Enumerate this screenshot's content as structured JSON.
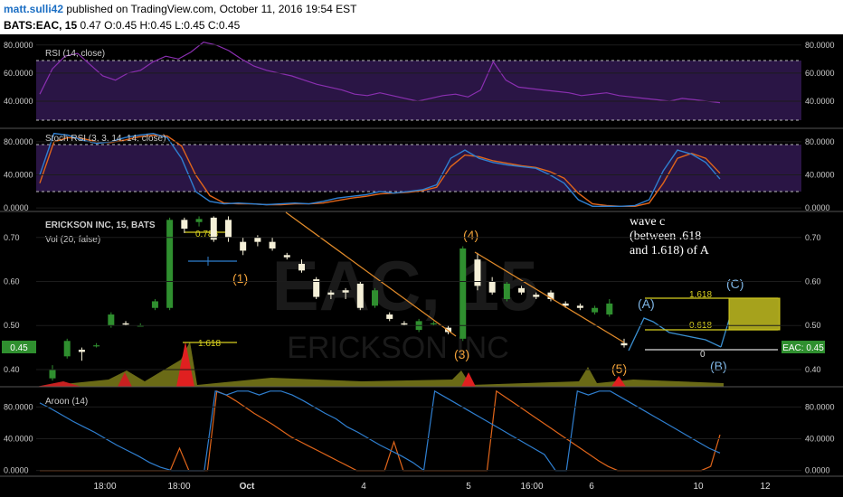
{
  "header": {
    "username": "matt.sulli42",
    "published": " published on TradingView.com, October 11, 2016 19:54 EST",
    "symbol": "BATS:EAC, 15",
    "ohlc": " 0.47 O:0.45 H:0.45 L:0.45 C:0.45"
  },
  "colors": {
    "panel_bg": "#000000",
    "rsi_band": "#3a1a55",
    "rsi_line": "#8a2fb0",
    "stoch_k": "#2f7fd0",
    "stoch_d": "#e0651a",
    "up_candle": "#2f8f2f",
    "down_candle": "#f5f0d8",
    "wave_label": "#f2a23a",
    "corrective_label": "#7fb6e6",
    "trendline": "#e08a2a",
    "fib": "#d8d020",
    "price_tag": "#2f8f2f"
  },
  "chart_data": [
    {
      "type": "line",
      "title": "RSI (14, close)",
      "ylim": [
        22,
        85
      ],
      "y_ticks": [
        "80.0000",
        "60.0000",
        "40.0000"
      ],
      "overbought": 70,
      "oversold": 30,
      "series": [
        {
          "values": [
            45,
            63,
            72,
            74,
            66,
            58,
            55,
            60,
            62,
            68,
            72,
            70,
            75,
            82,
            80,
            76,
            70,
            65,
            62,
            60,
            58,
            55,
            52,
            50,
            48,
            45,
            44,
            46,
            44,
            42,
            40,
            42,
            44,
            45,
            43,
            48,
            68,
            55,
            50,
            49,
            48,
            47,
            46,
            44,
            45,
            46,
            44,
            43,
            42,
            41,
            40,
            42,
            41,
            40,
            39
          ]
        }
      ]
    },
    {
      "type": "line",
      "title": "Stoch RSI (3, 3, 14, 14, close)",
      "ylim": [
        -2,
        93
      ],
      "y_ticks": [
        "80.0000",
        "40.0000",
        "0.0000"
      ],
      "upper_band": 80,
      "lower_band": 20,
      "series": [
        {
          "values": [
            40,
            90,
            88,
            82,
            78,
            80,
            85,
            88,
            90,
            85,
            60,
            20,
            8,
            5,
            6,
            5,
            4,
            5,
            6,
            5,
            8,
            12,
            14,
            16,
            20,
            18,
            20,
            22,
            28,
            60,
            70,
            60,
            55,
            52,
            50,
            48,
            40,
            30,
            10,
            2,
            2,
            2,
            3,
            10,
            45,
            70,
            65,
            55,
            35
          ]
        },
        {
          "values": [
            30,
            80,
            85,
            84,
            80,
            79,
            82,
            86,
            88,
            87,
            75,
            40,
            15,
            6,
            5,
            5,
            4,
            4,
            5,
            5,
            6,
            9,
            12,
            14,
            17,
            18,
            19,
            21,
            25,
            50,
            64,
            62,
            57,
            54,
            51,
            49,
            44,
            36,
            18,
            5,
            3,
            2,
            2,
            6,
            30,
            60,
            66,
            60,
            42
          ]
        }
      ]
    },
    {
      "type": "candlestick",
      "title": "ERICKSON INC, 15, BATS",
      "ylim": [
        0.365,
        0.755
      ],
      "y_ticks": [
        "0.70",
        "0.60",
        "0.50",
        "0.40"
      ],
      "x_tick_labels": [
        "18:00",
        "18:00",
        "Oct",
        "4",
        "5",
        "16:00",
        "6",
        "10",
        "12"
      ],
      "candles": [
        {
          "o": 0.38,
          "h": 0.41,
          "l": 0.375,
          "c": 0.4
        },
        {
          "o": 0.43,
          "h": 0.47,
          "l": 0.425,
          "c": 0.465
        },
        {
          "o": 0.445,
          "h": 0.45,
          "l": 0.42,
          "c": 0.44
        },
        {
          "o": 0.455,
          "h": 0.46,
          "l": 0.45,
          "c": 0.455
        },
        {
          "o": 0.5,
          "h": 0.53,
          "l": 0.495,
          "c": 0.525
        },
        {
          "o": 0.505,
          "h": 0.51,
          "l": 0.5,
          "c": 0.502
        },
        {
          "o": 0.5,
          "h": 0.505,
          "l": 0.498,
          "c": 0.5
        },
        {
          "o": 0.54,
          "h": 0.56,
          "l": 0.535,
          "c": 0.555
        },
        {
          "o": 0.54,
          "h": 0.745,
          "l": 0.535,
          "c": 0.74
        },
        {
          "o": 0.74,
          "h": 0.745,
          "l": 0.71,
          "c": 0.72
        },
        {
          "o": 0.735,
          "h": 0.748,
          "l": 0.725,
          "c": 0.742
        },
        {
          "o": 0.745,
          "h": 0.748,
          "l": 0.69,
          "c": 0.695
        },
        {
          "o": 0.74,
          "h": 0.748,
          "l": 0.69,
          "c": 0.7
        },
        {
          "o": 0.69,
          "h": 0.7,
          "l": 0.66,
          "c": 0.67
        },
        {
          "o": 0.7,
          "h": 0.705,
          "l": 0.68,
          "c": 0.69
        },
        {
          "o": 0.69,
          "h": 0.7,
          "l": 0.67,
          "c": 0.675
        },
        {
          "o": 0.66,
          "h": 0.665,
          "l": 0.65,
          "c": 0.655
        },
        {
          "o": 0.64,
          "h": 0.65,
          "l": 0.62,
          "c": 0.625
        },
        {
          "o": 0.605,
          "h": 0.61,
          "l": 0.56,
          "c": 0.565
        },
        {
          "o": 0.575,
          "h": 0.58,
          "l": 0.56,
          "c": 0.57
        },
        {
          "o": 0.58,
          "h": 0.585,
          "l": 0.56,
          "c": 0.575
        },
        {
          "o": 0.595,
          "h": 0.6,
          "l": 0.535,
          "c": 0.54
        },
        {
          "o": 0.545,
          "h": 0.585,
          "l": 0.54,
          "c": 0.58
        },
        {
          "o": 0.525,
          "h": 0.53,
          "l": 0.51,
          "c": 0.515
        },
        {
          "o": 0.505,
          "h": 0.51,
          "l": 0.5,
          "c": 0.502
        },
        {
          "o": 0.49,
          "h": 0.515,
          "l": 0.485,
          "c": 0.51
        },
        {
          "o": 0.505,
          "h": 0.51,
          "l": 0.5,
          "c": 0.505
        },
        {
          "o": 0.495,
          "h": 0.5,
          "l": 0.48,
          "c": 0.485
        },
        {
          "o": 0.47,
          "h": 0.68,
          "l": 0.465,
          "c": 0.675
        },
        {
          "o": 0.65,
          "h": 0.665,
          "l": 0.58,
          "c": 0.59
        },
        {
          "o": 0.6,
          "h": 0.61,
          "l": 0.57,
          "c": 0.575
        },
        {
          "o": 0.56,
          "h": 0.6,
          "l": 0.555,
          "c": 0.595
        },
        {
          "o": 0.585,
          "h": 0.59,
          "l": 0.57,
          "c": 0.575
        },
        {
          "o": 0.57,
          "h": 0.575,
          "l": 0.56,
          "c": 0.565
        },
        {
          "o": 0.575,
          "h": 0.58,
          "l": 0.555,
          "c": 0.56
        },
        {
          "o": 0.55,
          "h": 0.555,
          "l": 0.54,
          "c": 0.545
        },
        {
          "o": 0.545,
          "h": 0.55,
          "l": 0.535,
          "c": 0.54
        },
        {
          "o": 0.53,
          "h": 0.545,
          "l": 0.525,
          "c": 0.54
        },
        {
          "o": 0.525,
          "h": 0.56,
          "l": 0.52,
          "c": 0.55
        },
        {
          "o": 0.46,
          "h": 0.47,
          "l": 0.45,
          "c": 0.455
        }
      ]
    },
    {
      "type": "line",
      "title": "Aroon (14)",
      "ylim": [
        -5,
        102
      ],
      "y_ticks": [
        "80.0000",
        "40.0000",
        "0.0000"
      ],
      "series": [
        {
          "values": [
            85,
            78,
            70,
            62,
            55,
            48,
            40,
            32,
            25,
            18,
            10,
            4,
            0,
            0,
            0,
            0,
            100,
            95,
            100,
            100,
            95,
            100,
            100,
            95,
            88,
            80,
            72,
            65,
            55,
            48,
            40,
            32,
            25,
            18,
            10,
            0,
            100,
            92,
            84,
            76,
            68,
            60,
            52,
            44,
            36,
            28,
            20,
            0,
            0,
            100,
            95,
            100,
            100,
            92,
            84,
            76,
            68,
            60,
            52,
            44,
            36,
            28,
            22
          ]
        },
        {
          "values": [
            0,
            0,
            0,
            0,
            0,
            0,
            0,
            0,
            0,
            0,
            0,
            0,
            0,
            0,
            0,
            28,
            0,
            0,
            0,
            100,
            95,
            88,
            80,
            72,
            65,
            58,
            50,
            42,
            36,
            30,
            24,
            18,
            12,
            6,
            0,
            0,
            0,
            0,
            36,
            0,
            0,
            0,
            0,
            0,
            0,
            0,
            0,
            0,
            0,
            100,
            92,
            84,
            76,
            68,
            60,
            52,
            44,
            36,
            28,
            20,
            12,
            5,
            0,
            0,
            0,
            0,
            0,
            0,
            0,
            0,
            0,
            0,
            5,
            45
          ]
        }
      ]
    }
  ],
  "volume_title": "Vol (20, false)",
  "watermark": {
    "symbol": "EAC, 15",
    "name": "ERICKSON INC"
  },
  "price_tag": {
    "label": "0.45",
    "last_label": "EAC: 0.45"
  },
  "fib_labels": {
    "l1": "1.618",
    "l2": "0.786",
    "l3": "1.618",
    "l4": "0.618",
    "l5": "0"
  },
  "wave_labels": {
    "w1": "(1)",
    "w3": "(3)",
    "w4": "(4)",
    "w5": "(5)",
    "a": "(A)",
    "b": "(B)",
    "c": "(C)"
  },
  "annotation": {
    "line1": "wave c",
    "line2": "(between .618",
    "line3": "and 1.618) of A"
  }
}
